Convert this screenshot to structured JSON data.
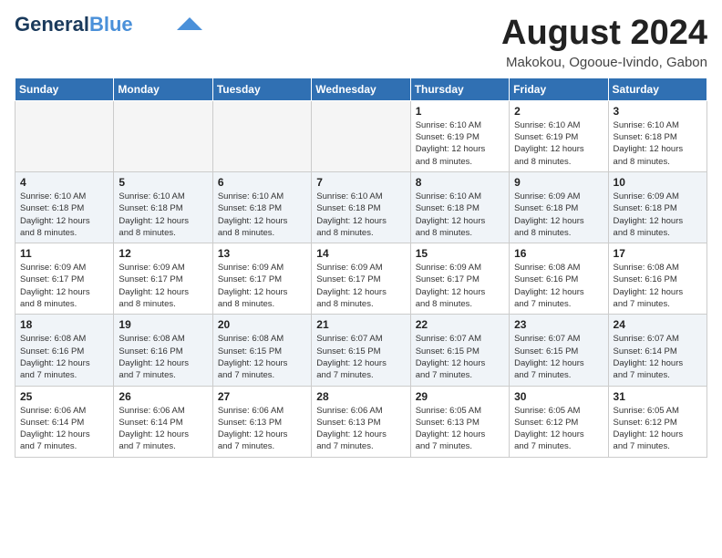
{
  "logo": {
    "line1": "General",
    "line2": "Blue"
  },
  "title": "August 2024",
  "location": "Makokou, Ogooue-Ivindo, Gabon",
  "weekdays": [
    "Sunday",
    "Monday",
    "Tuesday",
    "Wednesday",
    "Thursday",
    "Friday",
    "Saturday"
  ],
  "weeks": [
    [
      {
        "day": "",
        "info": ""
      },
      {
        "day": "",
        "info": ""
      },
      {
        "day": "",
        "info": ""
      },
      {
        "day": "",
        "info": ""
      },
      {
        "day": "1",
        "info": "Sunrise: 6:10 AM\nSunset: 6:19 PM\nDaylight: 12 hours\nand 8 minutes."
      },
      {
        "day": "2",
        "info": "Sunrise: 6:10 AM\nSunset: 6:19 PM\nDaylight: 12 hours\nand 8 minutes."
      },
      {
        "day": "3",
        "info": "Sunrise: 6:10 AM\nSunset: 6:18 PM\nDaylight: 12 hours\nand 8 minutes."
      }
    ],
    [
      {
        "day": "4",
        "info": "Sunrise: 6:10 AM\nSunset: 6:18 PM\nDaylight: 12 hours\nand 8 minutes."
      },
      {
        "day": "5",
        "info": "Sunrise: 6:10 AM\nSunset: 6:18 PM\nDaylight: 12 hours\nand 8 minutes."
      },
      {
        "day": "6",
        "info": "Sunrise: 6:10 AM\nSunset: 6:18 PM\nDaylight: 12 hours\nand 8 minutes."
      },
      {
        "day": "7",
        "info": "Sunrise: 6:10 AM\nSunset: 6:18 PM\nDaylight: 12 hours\nand 8 minutes."
      },
      {
        "day": "8",
        "info": "Sunrise: 6:10 AM\nSunset: 6:18 PM\nDaylight: 12 hours\nand 8 minutes."
      },
      {
        "day": "9",
        "info": "Sunrise: 6:09 AM\nSunset: 6:18 PM\nDaylight: 12 hours\nand 8 minutes."
      },
      {
        "day": "10",
        "info": "Sunrise: 6:09 AM\nSunset: 6:18 PM\nDaylight: 12 hours\nand 8 minutes."
      }
    ],
    [
      {
        "day": "11",
        "info": "Sunrise: 6:09 AM\nSunset: 6:17 PM\nDaylight: 12 hours\nand 8 minutes."
      },
      {
        "day": "12",
        "info": "Sunrise: 6:09 AM\nSunset: 6:17 PM\nDaylight: 12 hours\nand 8 minutes."
      },
      {
        "day": "13",
        "info": "Sunrise: 6:09 AM\nSunset: 6:17 PM\nDaylight: 12 hours\nand 8 minutes."
      },
      {
        "day": "14",
        "info": "Sunrise: 6:09 AM\nSunset: 6:17 PM\nDaylight: 12 hours\nand 8 minutes."
      },
      {
        "day": "15",
        "info": "Sunrise: 6:09 AM\nSunset: 6:17 PM\nDaylight: 12 hours\nand 8 minutes."
      },
      {
        "day": "16",
        "info": "Sunrise: 6:08 AM\nSunset: 6:16 PM\nDaylight: 12 hours\nand 7 minutes."
      },
      {
        "day": "17",
        "info": "Sunrise: 6:08 AM\nSunset: 6:16 PM\nDaylight: 12 hours\nand 7 minutes."
      }
    ],
    [
      {
        "day": "18",
        "info": "Sunrise: 6:08 AM\nSunset: 6:16 PM\nDaylight: 12 hours\nand 7 minutes."
      },
      {
        "day": "19",
        "info": "Sunrise: 6:08 AM\nSunset: 6:16 PM\nDaylight: 12 hours\nand 7 minutes."
      },
      {
        "day": "20",
        "info": "Sunrise: 6:08 AM\nSunset: 6:15 PM\nDaylight: 12 hours\nand 7 minutes."
      },
      {
        "day": "21",
        "info": "Sunrise: 6:07 AM\nSunset: 6:15 PM\nDaylight: 12 hours\nand 7 minutes."
      },
      {
        "day": "22",
        "info": "Sunrise: 6:07 AM\nSunset: 6:15 PM\nDaylight: 12 hours\nand 7 minutes."
      },
      {
        "day": "23",
        "info": "Sunrise: 6:07 AM\nSunset: 6:15 PM\nDaylight: 12 hours\nand 7 minutes."
      },
      {
        "day": "24",
        "info": "Sunrise: 6:07 AM\nSunset: 6:14 PM\nDaylight: 12 hours\nand 7 minutes."
      }
    ],
    [
      {
        "day": "25",
        "info": "Sunrise: 6:06 AM\nSunset: 6:14 PM\nDaylight: 12 hours\nand 7 minutes."
      },
      {
        "day": "26",
        "info": "Sunrise: 6:06 AM\nSunset: 6:14 PM\nDaylight: 12 hours\nand 7 minutes."
      },
      {
        "day": "27",
        "info": "Sunrise: 6:06 AM\nSunset: 6:13 PM\nDaylight: 12 hours\nand 7 minutes."
      },
      {
        "day": "28",
        "info": "Sunrise: 6:06 AM\nSunset: 6:13 PM\nDaylight: 12 hours\nand 7 minutes."
      },
      {
        "day": "29",
        "info": "Sunrise: 6:05 AM\nSunset: 6:13 PM\nDaylight: 12 hours\nand 7 minutes."
      },
      {
        "day": "30",
        "info": "Sunrise: 6:05 AM\nSunset: 6:12 PM\nDaylight: 12 hours\nand 7 minutes."
      },
      {
        "day": "31",
        "info": "Sunrise: 6:05 AM\nSunset: 6:12 PM\nDaylight: 12 hours\nand 7 minutes."
      }
    ]
  ]
}
